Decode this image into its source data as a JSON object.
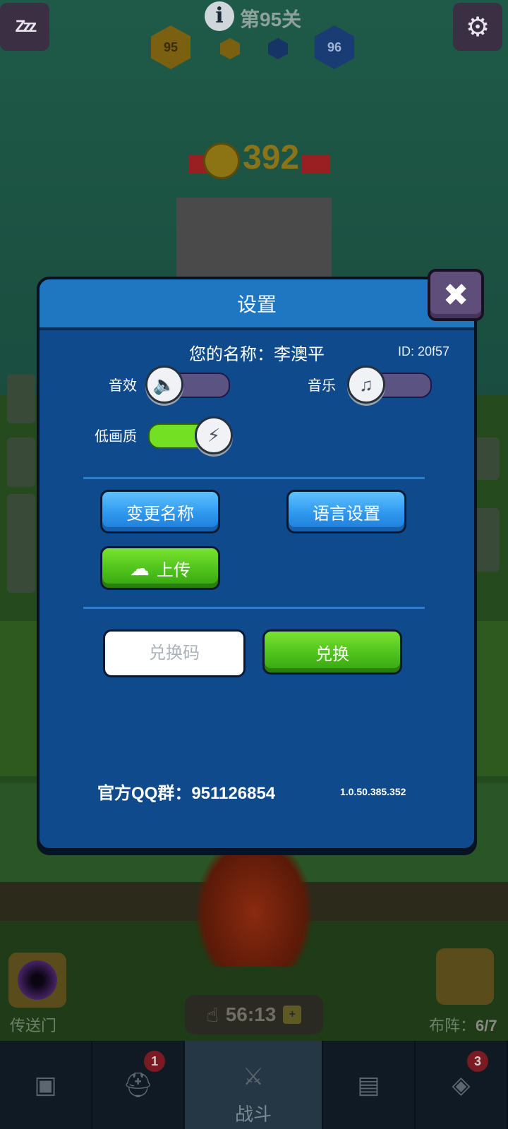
{
  "hud": {
    "level_text": "第95关",
    "left_hex_value": "95",
    "right_hex_value": "96",
    "coin_count": "392"
  },
  "dialog": {
    "title": "设置",
    "player_name": "您的名称：李澳平",
    "id_text": "ID:  20f57",
    "sound_label": "音效",
    "music_label": "音乐",
    "low_quality_label": "低画质",
    "sound_on": false,
    "music_on": false,
    "low_quality_on": true,
    "change_name_label": "变更名称",
    "language_label": "语言设置",
    "upload_label": "上传",
    "code_placeholder": "兑换码",
    "redeem_label": "兑换",
    "qq_group": "官方QQ群：951126854",
    "version": "1.0.50.385.352"
  },
  "bottom": {
    "portal_label": "传送门",
    "timer": "56:13",
    "formation_label": "布阵：",
    "formation_count": "6/7",
    "tabs": [
      {
        "id": "chest",
        "icon": "treasure-chest-icon",
        "badge": ""
      },
      {
        "id": "heroes",
        "icon": "viking-helmet-icon",
        "badge": "1"
      },
      {
        "id": "battle",
        "icon": "crossed-swords-icon",
        "label": "战斗"
      },
      {
        "id": "book",
        "icon": "spellbook-icon",
        "badge": ""
      },
      {
        "id": "amulet",
        "icon": "amulet-icon",
        "badge": "3"
      }
    ]
  },
  "colors": {
    "dialog_bg": "#0f4a8d",
    "header_bg": "#1f77c2",
    "toggle_on": "#73e023",
    "toggle_off": "#5b5482",
    "blue_button": "#2f97ee",
    "green_button": "#4ec21c"
  }
}
